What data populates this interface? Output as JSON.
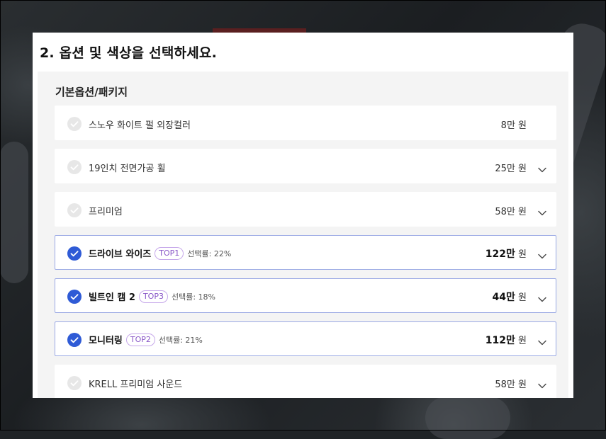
{
  "heading": "2. 옵션 및 색상을 선택하세요.",
  "section_title": "기본옵션/패키지",
  "colors": {
    "accent": "#2f5bd6",
    "badge": "#8a58c8",
    "selected_border": "#9aa9e4"
  },
  "rows": [
    {
      "label": "스노우 화이트 펄 외장컬러",
      "price": "8만",
      "unit": " 원",
      "selected": false,
      "expandable": false,
      "badge": "",
      "rate": ""
    },
    {
      "label": "19인치 전면가공 휠",
      "price": "25만",
      "unit": " 원",
      "selected": false,
      "expandable": true,
      "badge": "",
      "rate": ""
    },
    {
      "label": "프리미엄",
      "price": "58만",
      "unit": " 원",
      "selected": false,
      "expandable": true,
      "badge": "",
      "rate": ""
    },
    {
      "label": "드라이브 와이즈",
      "price": "122만",
      "unit": " 원",
      "selected": true,
      "expandable": true,
      "badge": "TOP1",
      "rate": "선택률: 22%"
    },
    {
      "label": "빌트인 캠 2",
      "price": "44만",
      "unit": " 원",
      "selected": true,
      "expandable": true,
      "badge": "TOP3",
      "rate": "선택률: 18%"
    },
    {
      "label": "모니터링",
      "price": "112만",
      "unit": " 원",
      "selected": true,
      "expandable": true,
      "badge": "TOP2",
      "rate": "선택률: 21%"
    },
    {
      "label": "KRELL 프리미엄 사운드",
      "price": "58만",
      "unit": " 원",
      "selected": false,
      "expandable": true,
      "badge": "",
      "rate": ""
    }
  ]
}
